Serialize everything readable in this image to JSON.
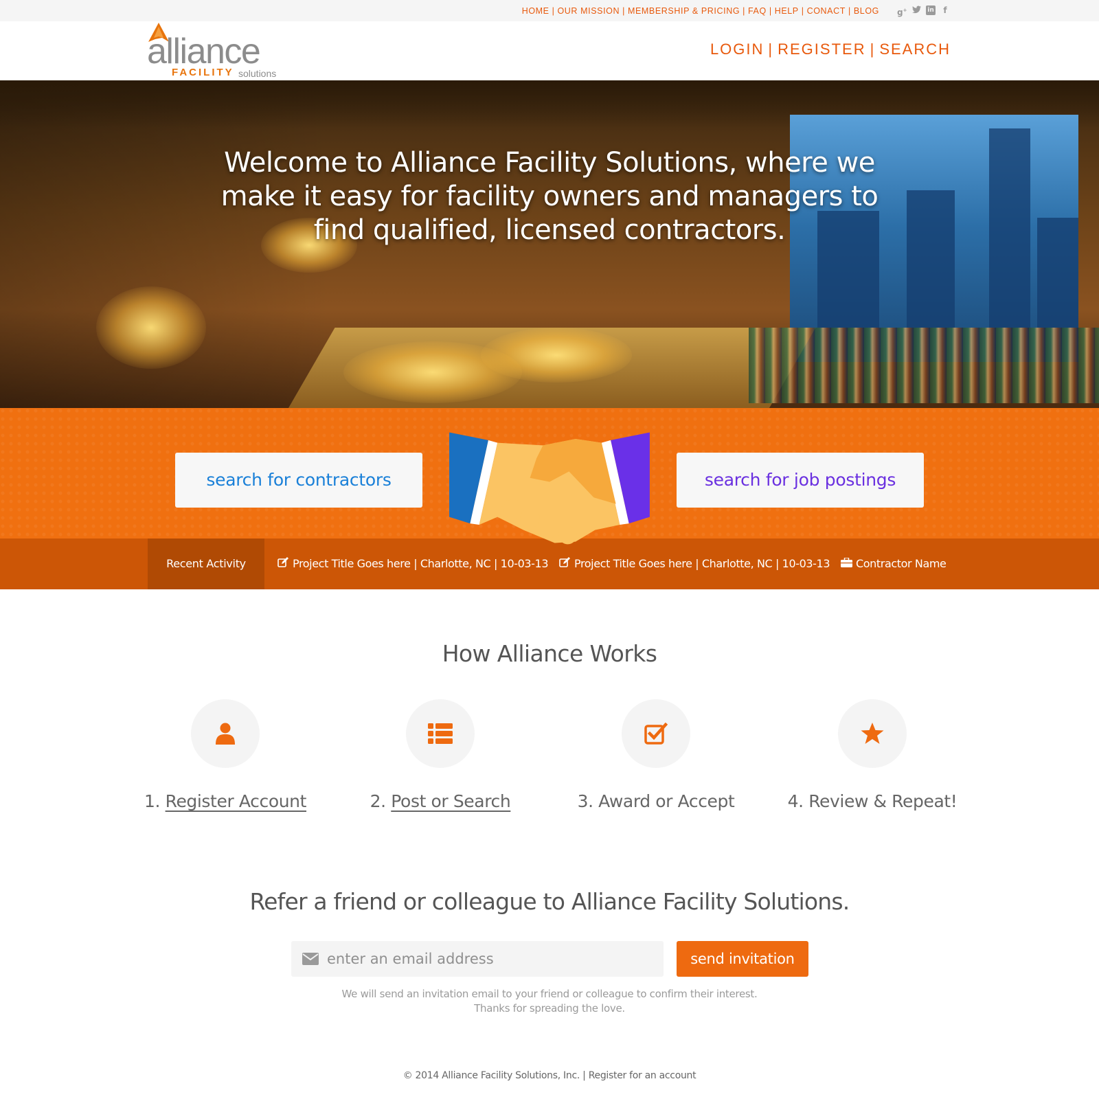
{
  "top_nav": {
    "items": [
      "HOME",
      "OUR MISSION",
      "MEMBERSHIP & PRICING",
      "FAQ",
      "HELP",
      "CONACT",
      "BLOG"
    ],
    "social": [
      "google-plus-icon",
      "twitter-icon",
      "linkedin-icon",
      "facebook-icon"
    ]
  },
  "logo": {
    "word": "alliance",
    "sub1": "FACILITY",
    "sub2": "solutions"
  },
  "main_nav": {
    "login": "LOGIN",
    "register": "REGISTER",
    "search": "SEARCH",
    "separator": "|"
  },
  "hero": {
    "headline": "Welcome to Alliance Facility Solutions, where we make it easy for facility owners and managers to find qualified, licensed contractors."
  },
  "search": {
    "contractors_label": "search for contractors",
    "jobs_label": "search for job postings"
  },
  "activity": {
    "label": "Recent Activity",
    "items": [
      {
        "icon": "edit-icon",
        "text": "Project Title Goes here | Charlotte, NC | 10-03-13"
      },
      {
        "icon": "edit-icon",
        "text": "Project Title Goes here | Charlotte, NC | 10-03-13"
      },
      {
        "icon": "briefcase-icon",
        "text": "Contractor Name"
      }
    ]
  },
  "how": {
    "title": "How Alliance Works",
    "steps": [
      {
        "num": "1.",
        "label": "Register Account",
        "icon": "user-icon",
        "linked": true
      },
      {
        "num": "2.",
        "label": "Post or Search",
        "icon": "list-icon",
        "linked": true
      },
      {
        "num": "3.",
        "label": "Award or Accept",
        "icon": "checkbox-icon",
        "linked": false
      },
      {
        "num": "4.",
        "label": "Review & Repeat!",
        "icon": "star-icon",
        "linked": false
      }
    ]
  },
  "refer": {
    "title": "Refer a friend or colleague to Alliance Facility Solutions.",
    "email_placeholder": "enter an email address",
    "email_value": "",
    "send_label": "send invitation",
    "note_line1": "We will send an invitation email to your friend or colleague to confirm their interest.",
    "note_line2": "Thanks for spreading the love."
  },
  "footer": {
    "copyright": "© 2014 Alliance Facility Solutions, Inc.",
    "separator": "|",
    "register_link": "Register for an account"
  },
  "colors": {
    "accent": "#ee6a10",
    "nav_orange": "#e8590c",
    "activity_bar": "#cc5606",
    "contractors_blue": "#1a80d8",
    "jobs_purple": "#6a30e0"
  }
}
